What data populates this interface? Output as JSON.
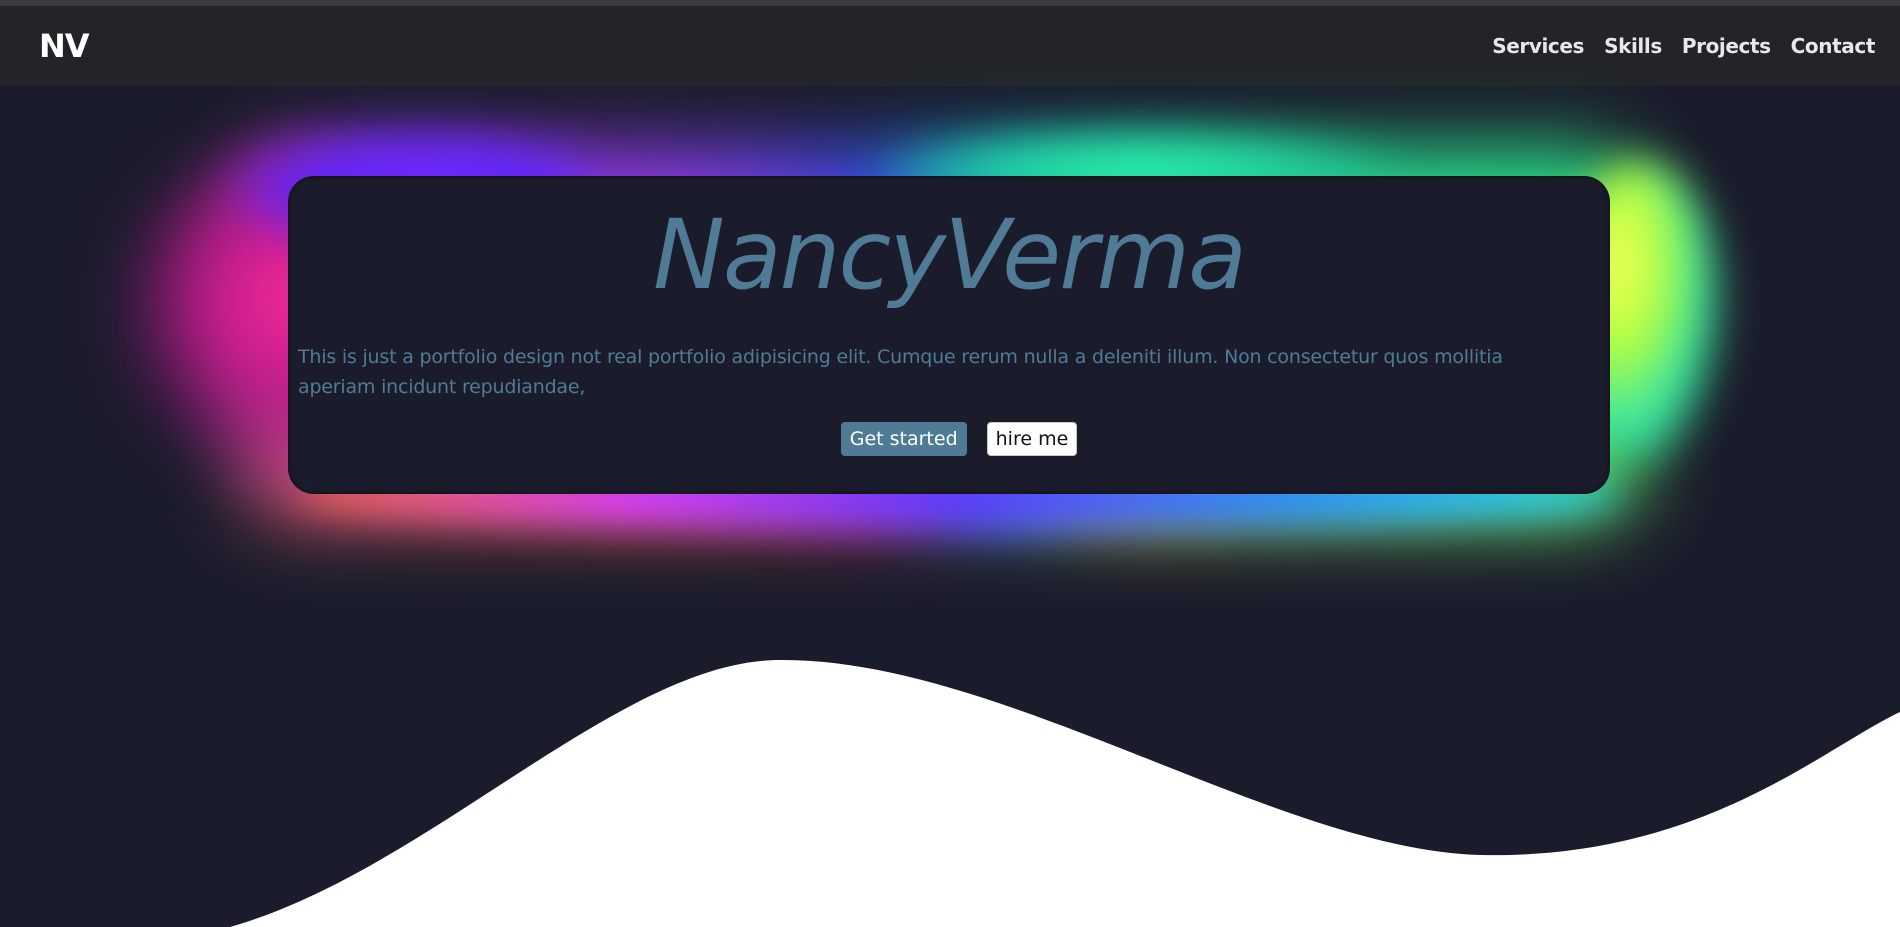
{
  "navbar": {
    "brand": "NV",
    "links": [
      "Services",
      "Skills",
      "Projects",
      "Contact"
    ]
  },
  "hero": {
    "title": "NancyVerma",
    "description": "This is just a portfolio design not real portfolio adipisicing elit. Cumque rerum nulla a deleniti illum. Non consectetur quos mollitia aperiam incidunt repudiandae,",
    "primary_button": "Get started",
    "secondary_button": "hire me"
  },
  "colors": {
    "background": "#1b1c2b",
    "navbar": "#222427",
    "accent": "#4f7b96",
    "wave": "#ffffff"
  }
}
